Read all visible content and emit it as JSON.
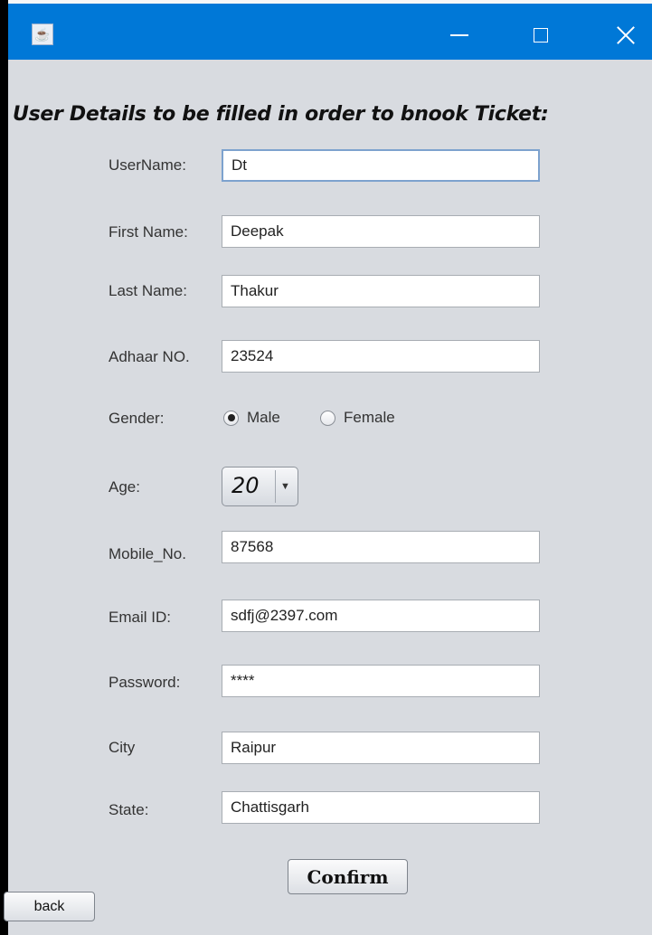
{
  "window": {
    "icon": "java-icon",
    "controls": [
      "minimize-icon",
      "maximize-icon",
      "close-icon"
    ]
  },
  "form": {
    "heading": "User Details to be filled in order to bnook Ticket:",
    "username": {
      "label": "UserName:",
      "value": "Dt"
    },
    "first_name": {
      "label": "First Name:",
      "value": "Deepak"
    },
    "last_name": {
      "label": "Last Name:",
      "value": "Thakur"
    },
    "adhaar": {
      "label": "Adhaar NO.",
      "value": "23524"
    },
    "gender": {
      "label": "Gender:",
      "options": [
        "Male",
        "Female"
      ],
      "selected": "Male"
    },
    "age": {
      "label": "Age:",
      "value": "20"
    },
    "mobile": {
      "label": "Mobile_No.",
      "value": "87568"
    },
    "email": {
      "label": "Email ID:",
      "value": "sdfj@2397.com"
    },
    "password": {
      "label": "Password:",
      "value": "****"
    },
    "city": {
      "label": "City",
      "value": "Raipur"
    },
    "state": {
      "label": "State:",
      "value": "Chattisgarh"
    }
  },
  "buttons": {
    "confirm": "Confirm",
    "back": "back"
  }
}
